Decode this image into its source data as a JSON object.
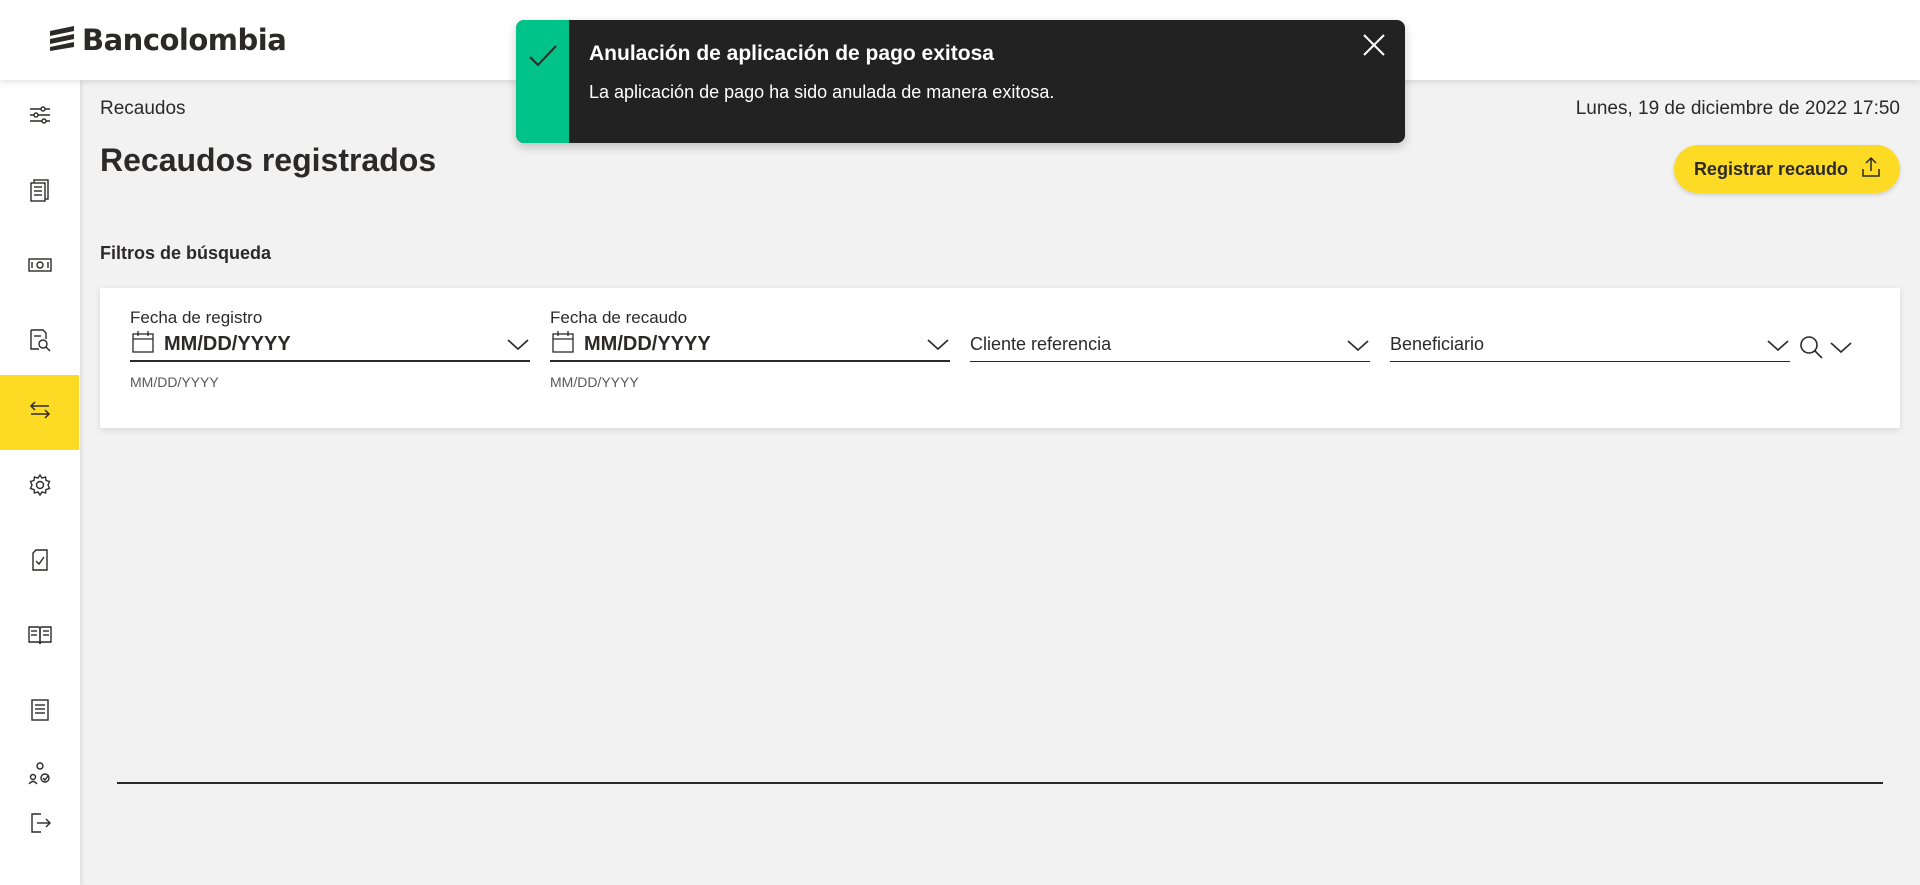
{
  "app": {
    "brand": "Bancolombia",
    "accent_color": "#fdda24",
    "success_color": "#00c389"
  },
  "sidebar": {
    "items": [
      {
        "icon": "sliders-icon"
      },
      {
        "icon": "document-list-icon"
      },
      {
        "icon": "cash-icon"
      },
      {
        "icon": "document-search-icon"
      },
      {
        "icon": "transfer-arrows-icon",
        "active": true
      },
      {
        "icon": "gear-icon"
      },
      {
        "icon": "document-check-icon"
      },
      {
        "icon": "open-book-icon"
      },
      {
        "icon": "notebook-icon"
      },
      {
        "icon": "user-network-icon"
      },
      {
        "icon": "logout-icon"
      }
    ]
  },
  "header": {
    "breadcrumb": "Recaudos",
    "datetime": "Lunes, 19 de diciembre de 2022 17:50",
    "title": "Recaudos registrados",
    "register_button": "Registrar recaudo"
  },
  "filters": {
    "section_title": "Filtros de búsqueda",
    "fecha_registro": {
      "label": "Fecha de registro",
      "value": "MM/DD/YYYY",
      "helper": "MM/DD/YYYY"
    },
    "fecha_recaudo": {
      "label": "Fecha de recaudo",
      "value": "MM/DD/YYYY",
      "helper": "MM/DD/YYYY"
    },
    "cliente_referencia": {
      "placeholder": "Cliente referencia"
    },
    "beneficiario": {
      "placeholder": "Beneficiario"
    }
  },
  "toast": {
    "title": "Anulación de aplicación de pago exitosa",
    "message": "La aplicación de pago ha sido anulada de manera exitosa."
  }
}
